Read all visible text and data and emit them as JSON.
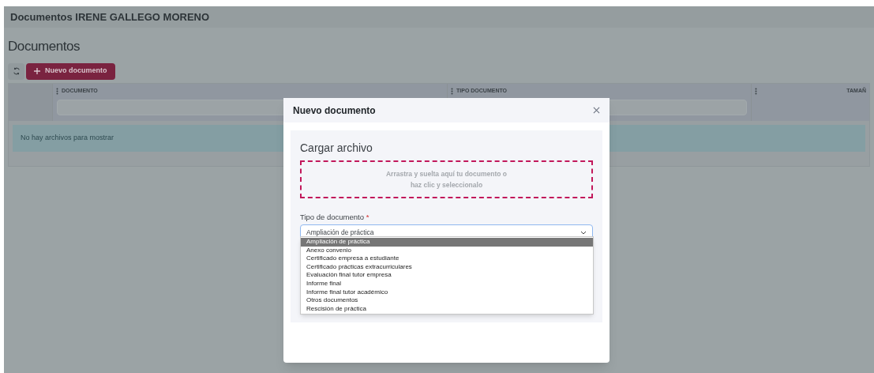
{
  "page_title": "Documentos IRENE GALLEGO MORENO",
  "section_title": "Documentos",
  "toolbar": {
    "new_button": "Nuevo documento"
  },
  "table": {
    "columns": [
      "DOCUMENTO",
      "TIPO DOCUMENTO",
      "TAMAÑ"
    ],
    "empty_message": "No hay archivos para mostrar"
  },
  "modal": {
    "title": "Nuevo documento",
    "section_title": "Cargar archivo",
    "dropzone_lines": [
      "Arrastra y suelta aquí tu documento o",
      "haz clic y seleccionalo"
    ],
    "field_label": "Tipo de documento",
    "required_mark": "*",
    "value": "Ampliación de práctica",
    "options": [
      {
        "label": "Ampliación de práctica",
        "selected": true
      },
      {
        "label": "Anexo convenio",
        "selected": false
      },
      {
        "label": "Certificado empresa a estudiante",
        "selected": false
      },
      {
        "label": "Certificado prácticas extracurriculares",
        "selected": false
      },
      {
        "label": "Evaluación final tutor empresa",
        "selected": false
      },
      {
        "label": "Informe final",
        "selected": false
      },
      {
        "label": "Informe final tutor académico",
        "selected": false
      },
      {
        "label": "Otros documentos",
        "selected": false
      },
      {
        "label": "Rescisión de práctica",
        "selected": false
      }
    ]
  }
}
